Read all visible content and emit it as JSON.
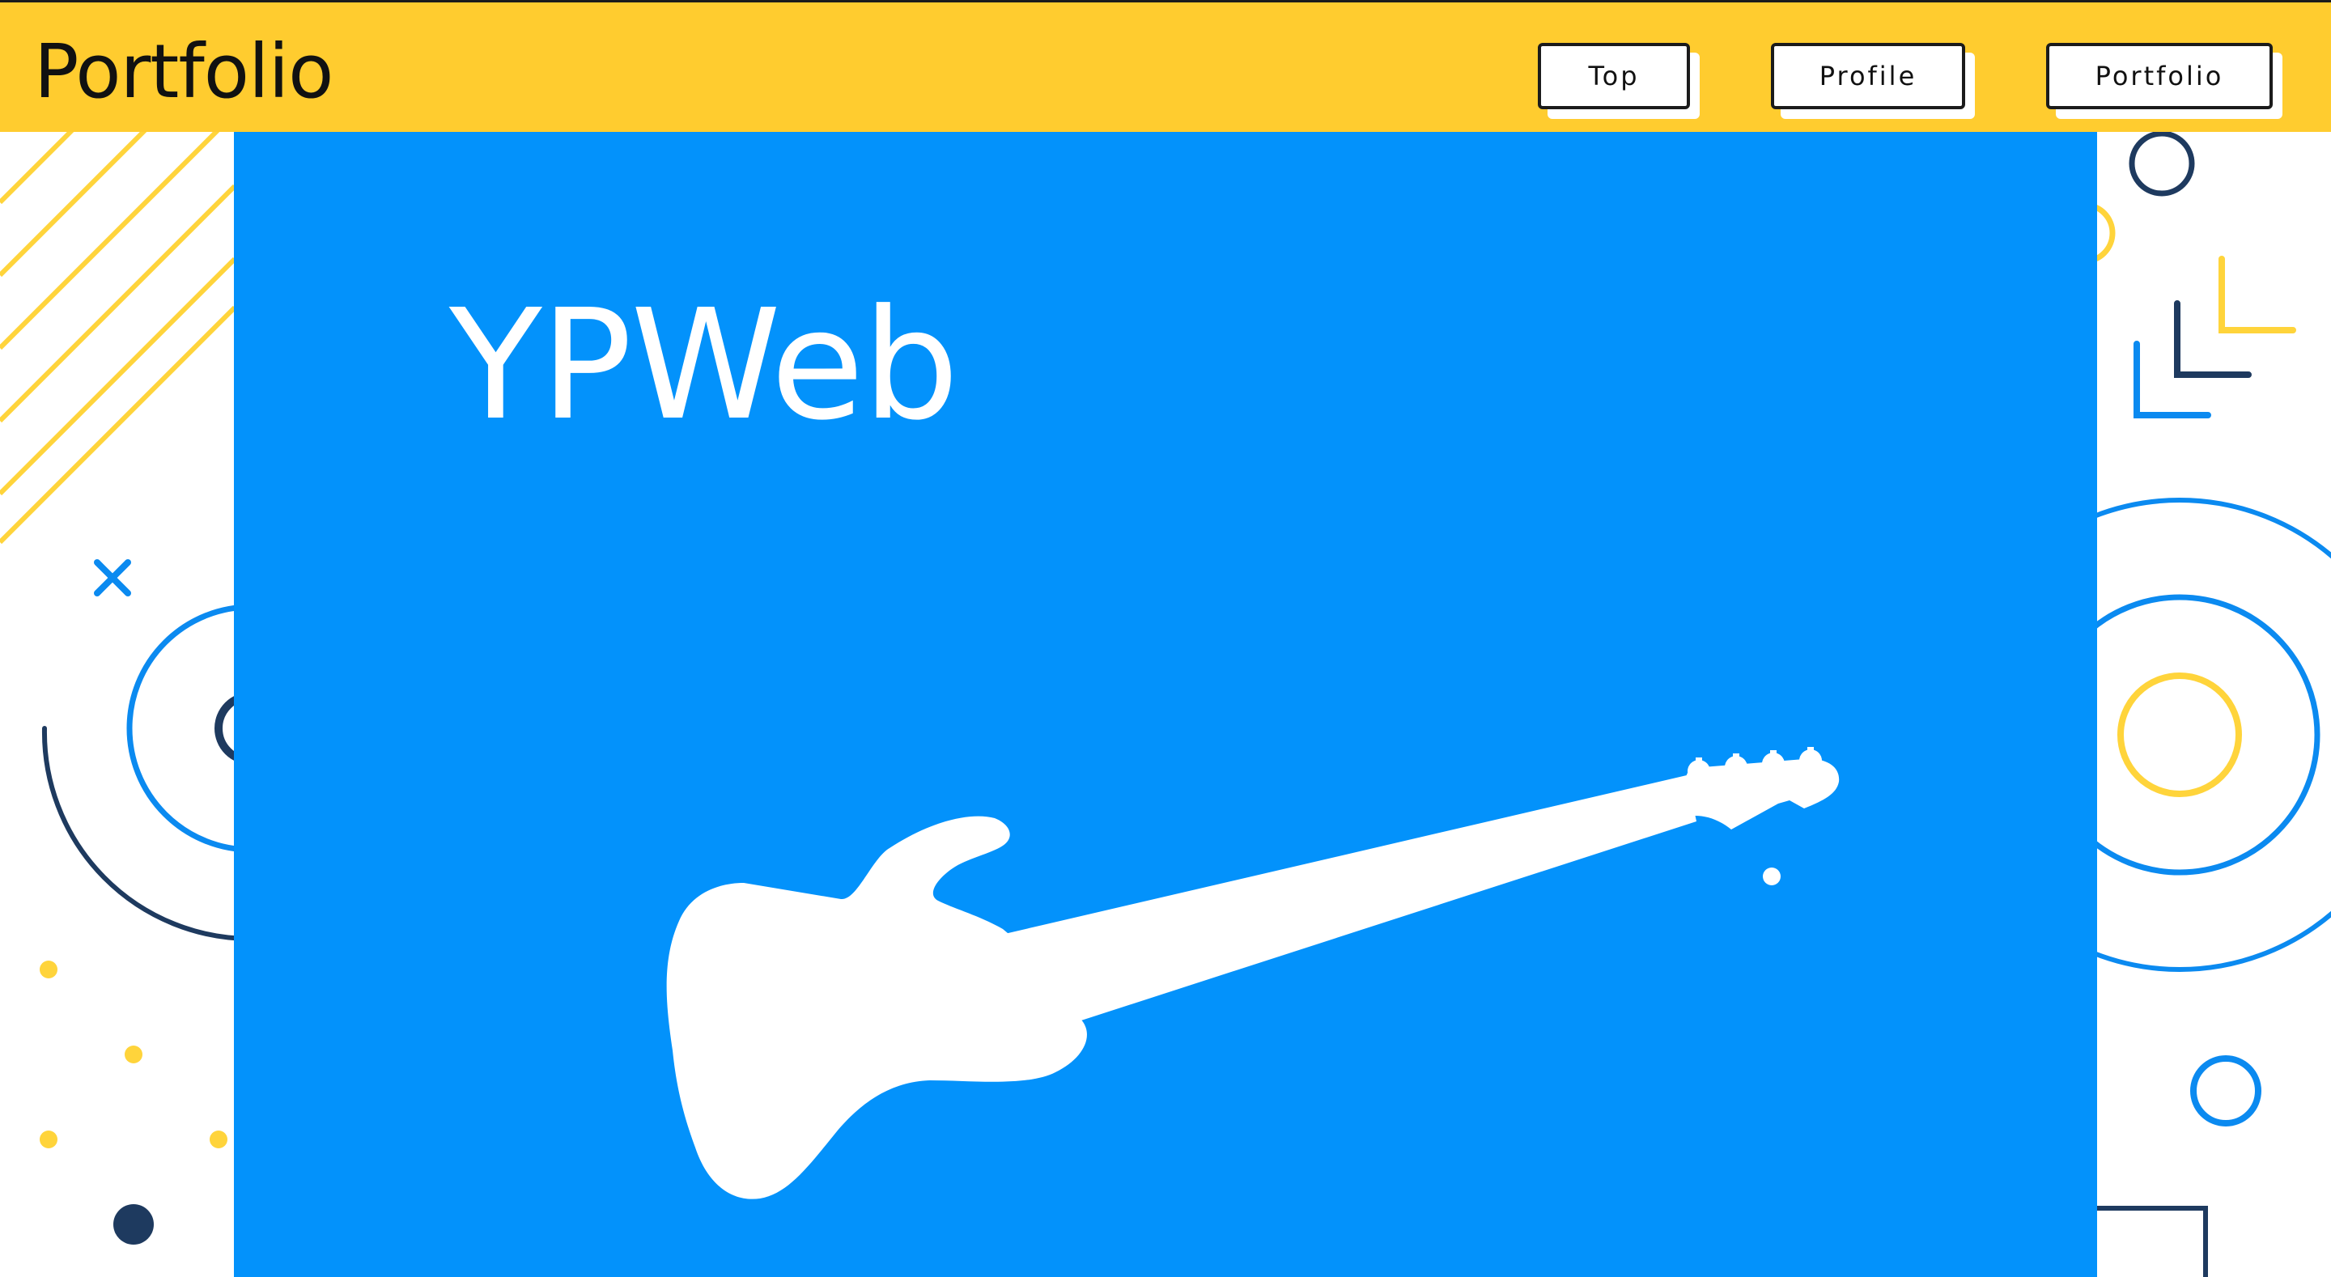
{
  "header": {
    "brand": "Portfolio",
    "nav": [
      {
        "label": "Top"
      },
      {
        "label": "Profile"
      },
      {
        "label": "Portfolio"
      }
    ]
  },
  "hero": {
    "title": "YPWeb",
    "illustration": "bass-guitar-icon"
  },
  "colors": {
    "header_bg": "#FFCC2F",
    "hero_bg": "#0392FB",
    "accent_navy": "#1E3A5F",
    "accent_yellow": "#FFD43B",
    "accent_blue": "#0B8AF0"
  }
}
